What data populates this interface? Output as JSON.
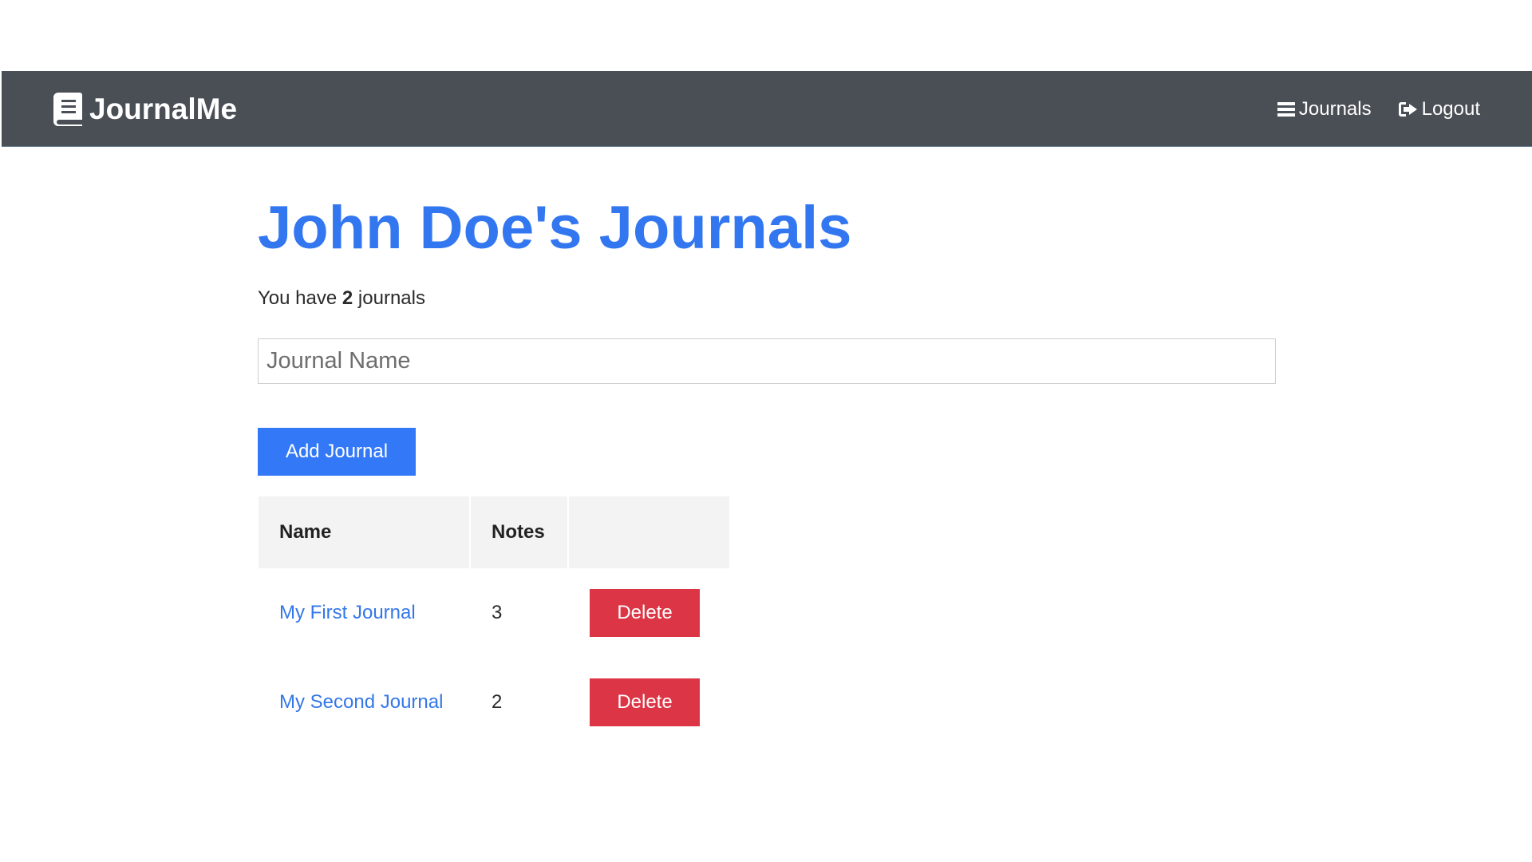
{
  "navbar": {
    "brand": "JournalMe",
    "links": [
      {
        "label": "Journals",
        "icon": "bars-icon"
      },
      {
        "label": "Logout",
        "icon": "sign-out-icon"
      }
    ]
  },
  "page": {
    "title": "John Doe's Journals",
    "summary_prefix": "You have",
    "journal_count": "2",
    "summary_suffix": "journals"
  },
  "form": {
    "name_placeholder": "Journal Name",
    "name_value": "",
    "add_label": "Add Journal"
  },
  "table": {
    "headers": [
      "Name",
      "Notes",
      ""
    ],
    "rows": [
      {
        "name": "My First Journal",
        "notes": "3",
        "action": "Delete"
      },
      {
        "name": "My Second Journal",
        "notes": "2",
        "action": "Delete"
      }
    ]
  },
  "colors": {
    "navbar_bg": "#4a4f56",
    "accent": "#3378f6",
    "danger": "#dc3545",
    "link": "#3377e8"
  }
}
